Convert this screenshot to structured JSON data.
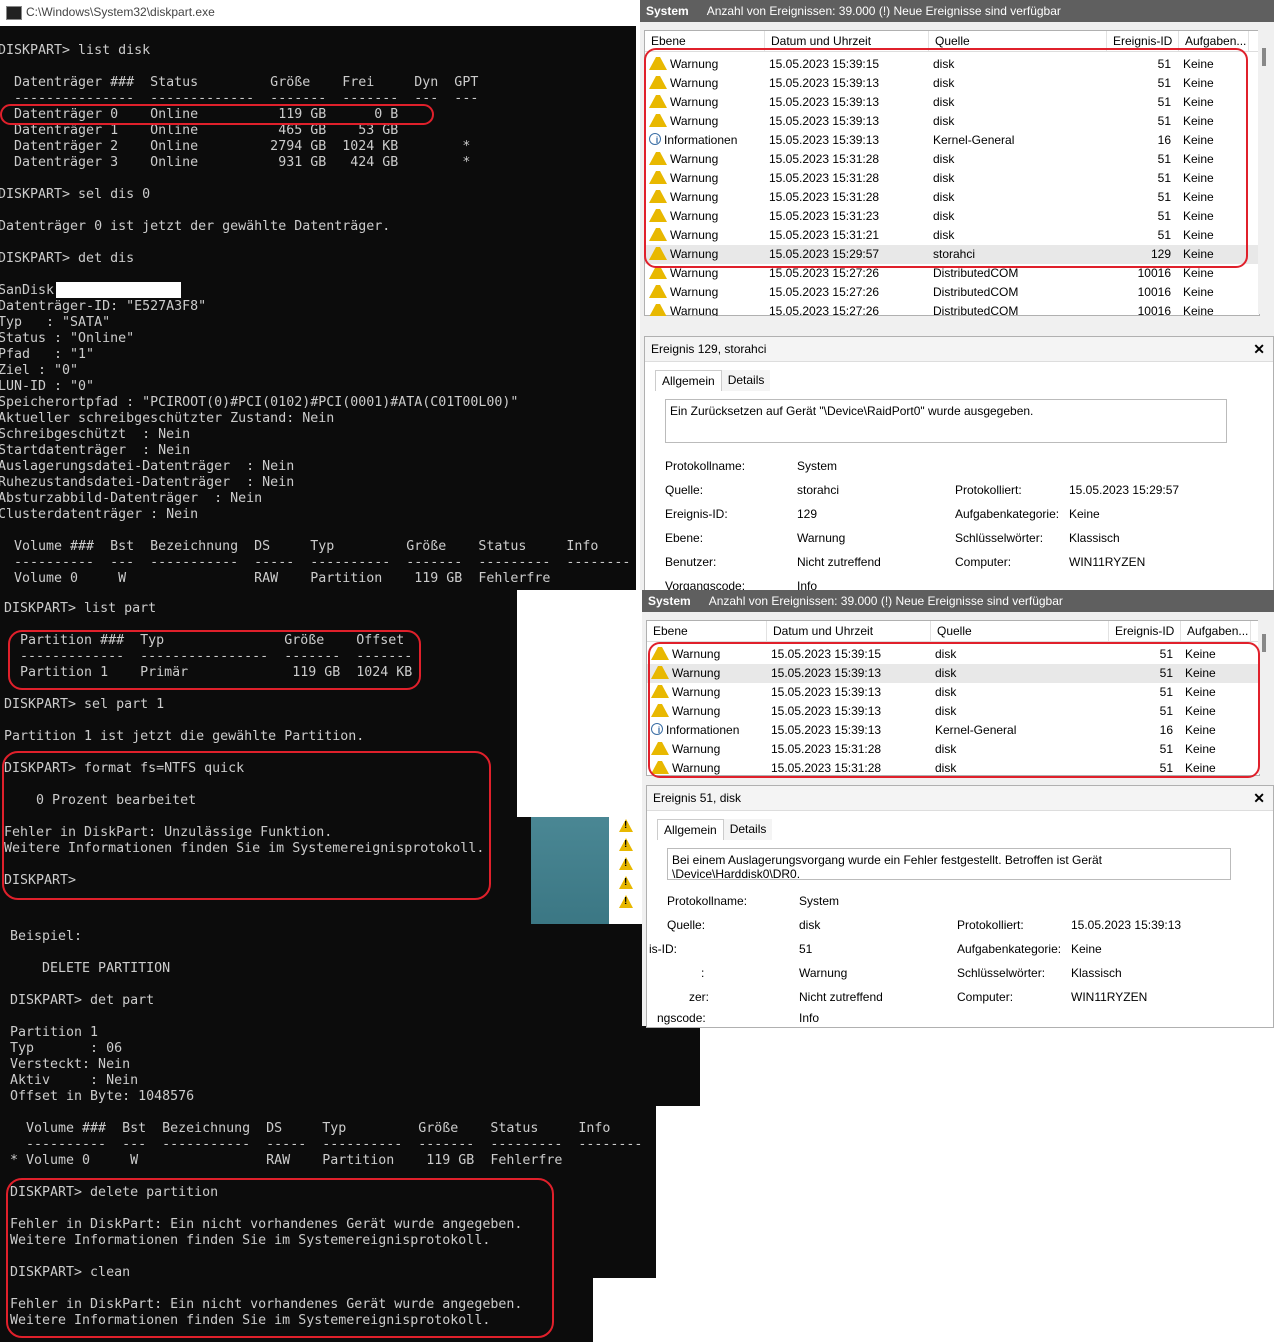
{
  "console_window": {
    "title": "C:\\Windows\\System32\\diskpart.exe"
  },
  "console_top_lines": [
    "",
    "DISKPART> list disk",
    "",
    "  Datenträger ###  Status         Größe    Frei     Dyn  GPT",
    "  ---------------  -------------  -------  -------  ---  ---",
    "  Datenträger 0    Online          119 GB      0 B",
    "  Datenträger 1    Online          465 GB    53 GB",
    "  Datenträger 2    Online         2794 GB  1024 KB        *",
    "  Datenträger 3    Online          931 GB   424 GB        *",
    "",
    "DISKPART> sel dis 0",
    "",
    "Datenträger 0 ist jetzt der gewählte Datenträger.",
    "",
    "DISKPART> det dis",
    "",
    "SanDisk",
    "Datenträger-ID: \"E527A3F8\"",
    "Typ   : \"SATA\"",
    "Status : \"Online\"",
    "Pfad   : \"1\"",
    "Ziel : \"0\"",
    "LUN-ID : \"0\"",
    "Speicherortpfad : \"PCIROOT(0)#PCI(0102)#PCI(0001)#ATA(C01T00L00)\"",
    "Aktueller schreibgeschützter Zustand: Nein",
    "Schreibgeschützt  : Nein",
    "Startdatenträger  : Nein",
    "Auslagerungsdatei-Datenträger  : Nein",
    "Ruhezustandsdatei-Datenträger  : Nein",
    "Absturzabbild-Datenträger  : Nein",
    "Clusterdatenträger : Nein",
    "",
    "  Volume ###  Bst  Bezeichnung  DS     Typ         Größe    Status     Info",
    "  ----------  ---  -----------  -----  ----------  -------  ---------  --------",
    "  Volume 0     W                RAW    Partition    119 GB  Fehlerfre"
  ],
  "console_mid_lines": [
    "DISKPART> list part",
    "",
    "  Partition ###  Typ               Größe    Offset",
    "  -------------  ----------------  -------  -------",
    "  Partition 1    Primär             119 GB  1024 KB",
    "",
    "DISKPART> sel part 1",
    "",
    "Partition 1 ist jetzt die gewählte Partition.",
    "",
    "DISKPART> format fs=NTFS quick",
    "",
    "    0 Prozent bearbeitet",
    "",
    "Fehler in DiskPart: Unzulässige Funktion.",
    "Weitere Informationen finden Sie im Systemereignisprotokoll.",
    "",
    "DISKPART>"
  ],
  "console_bottom_lines": [
    "Beispiel:",
    "",
    "    DELETE PARTITION",
    "",
    "DISKPART> det part",
    "",
    "Partition 1",
    "Typ       : 06",
    "Versteckt: Nein",
    "Aktiv     : Nein",
    "Offset in Byte: 1048576",
    "",
    "  Volume ###  Bst  Bezeichnung  DS     Typ         Größe    Status     Info",
    "  ----------  ---  -----------  -----  ----------  -------  ---------  --------",
    "* Volume 0     W                RAW    Partition    119 GB  Fehlerfre",
    "",
    "DISKPART> delete partition",
    "",
    "Fehler in DiskPart: Ein nicht vorhandenes Gerät wurde angegeben.",
    "Weitere Informationen finden Sie im Systemereignisprotokoll.",
    "",
    "DISKPART> clean",
    "",
    "Fehler in DiskPart: Ein nicht vorhandenes Gerät wurde angegeben.",
    "Weitere Informationen finden Sie im Systemereignisprotokoll."
  ],
  "event_viewer_1": {
    "header_name": "System",
    "header_text": "Anzahl von Ereignissen: 39.000 (!) Neue Ereignisse sind verfügbar",
    "columns": [
      "Ebene",
      "Datum und Uhrzeit",
      "Quelle",
      "Ereignis-ID",
      "Aufgaben..."
    ],
    "rows": [
      {
        "level": "Warnung",
        "icon": "warning-icon",
        "date": "15.05.2023 15:39:15",
        "source": "disk",
        "id": "51",
        "task": "Keine"
      },
      {
        "level": "Warnung",
        "icon": "warning-icon",
        "date": "15.05.2023 15:39:13",
        "source": "disk",
        "id": "51",
        "task": "Keine"
      },
      {
        "level": "Warnung",
        "icon": "warning-icon",
        "date": "15.05.2023 15:39:13",
        "source": "disk",
        "id": "51",
        "task": "Keine"
      },
      {
        "level": "Warnung",
        "icon": "warning-icon",
        "date": "15.05.2023 15:39:13",
        "source": "disk",
        "id": "51",
        "task": "Keine"
      },
      {
        "level": "Informationen",
        "icon": "info-icon",
        "date": "15.05.2023 15:39:13",
        "source": "Kernel-General",
        "id": "16",
        "task": "Keine"
      },
      {
        "level": "Warnung",
        "icon": "warning-icon",
        "date": "15.05.2023 15:31:28",
        "source": "disk",
        "id": "51",
        "task": "Keine"
      },
      {
        "level": "Warnung",
        "icon": "warning-icon",
        "date": "15.05.2023 15:31:28",
        "source": "disk",
        "id": "51",
        "task": "Keine"
      },
      {
        "level": "Warnung",
        "icon": "warning-icon",
        "date": "15.05.2023 15:31:28",
        "source": "disk",
        "id": "51",
        "task": "Keine"
      },
      {
        "level": "Warnung",
        "icon": "warning-icon",
        "date": "15.05.2023 15:31:23",
        "source": "disk",
        "id": "51",
        "task": "Keine"
      },
      {
        "level": "Warnung",
        "icon": "warning-icon",
        "date": "15.05.2023 15:31:21",
        "source": "disk",
        "id": "51",
        "task": "Keine"
      },
      {
        "level": "Warnung",
        "icon": "warning-icon",
        "date": "15.05.2023 15:29:57",
        "source": "storahci",
        "id": "129",
        "task": "Keine",
        "selected": true
      },
      {
        "level": "Warnung",
        "icon": "warning-icon",
        "date": "15.05.2023 15:27:26",
        "source": "DistributedCOM",
        "id": "10016",
        "task": "Keine"
      },
      {
        "level": "Warnung",
        "icon": "warning-icon",
        "date": "15.05.2023 15:27:26",
        "source": "DistributedCOM",
        "id": "10016",
        "task": "Keine"
      },
      {
        "level": "Warnung",
        "icon": "warning-icon",
        "date": "15.05.2023 15:27:26",
        "source": "DistributedCOM",
        "id": "10016",
        "task": "Keine"
      }
    ],
    "detail": {
      "title": "Ereignis 129, storahci",
      "close": "✕",
      "tab_general": "Allgemein",
      "tab_details": "Details",
      "message": "Ein Zurücksetzen auf Gerät \"\\Device\\RaidPort0\" wurde ausgegeben.",
      "fields": {
        "logname_label": "Protokollname:",
        "logname": "System",
        "source_label": "Quelle:",
        "source": "storahci",
        "logged_label": "Protokolliert:",
        "logged": "15.05.2023 15:29:57",
        "eventid_label": "Ereignis-ID:",
        "eventid": "129",
        "taskcat_label": "Aufgabenkategorie:",
        "taskcat": "Keine",
        "level_label": "Ebene:",
        "level": "Warnung",
        "keywords_label": "Schlüsselwörter:",
        "keywords": "Klassisch",
        "user_label": "Benutzer:",
        "user": "Nicht zutreffend",
        "computer_label": "Computer:",
        "computer": "WIN11RYZEN",
        "opcode_label": "Vorgangscode:",
        "opcode": "Info"
      }
    }
  },
  "event_viewer_2": {
    "header_name": "System",
    "header_text": "Anzahl von Ereignissen: 39.000 (!) Neue Ereignisse sind verfügbar",
    "columns": [
      "Ebene",
      "Datum und Uhrzeit",
      "Quelle",
      "Ereignis-ID",
      "Aufgaben..."
    ],
    "rows": [
      {
        "level": "Warnung",
        "icon": "warning-icon",
        "date": "15.05.2023 15:39:15",
        "source": "disk",
        "id": "51",
        "task": "Keine"
      },
      {
        "level": "Warnung",
        "icon": "warning-icon",
        "date": "15.05.2023 15:39:13",
        "source": "disk",
        "id": "51",
        "task": "Keine",
        "selected": true
      },
      {
        "level": "Warnung",
        "icon": "warning-icon",
        "date": "15.05.2023 15:39:13",
        "source": "disk",
        "id": "51",
        "task": "Keine"
      },
      {
        "level": "Warnung",
        "icon": "warning-icon",
        "date": "15.05.2023 15:39:13",
        "source": "disk",
        "id": "51",
        "task": "Keine"
      },
      {
        "level": "Informationen",
        "icon": "info-icon",
        "date": "15.05.2023 15:39:13",
        "source": "Kernel-General",
        "id": "16",
        "task": "Keine"
      },
      {
        "level": "Warnung",
        "icon": "warning-icon",
        "date": "15.05.2023 15:31:28",
        "source": "disk",
        "id": "51",
        "task": "Keine"
      },
      {
        "level": "Warnung",
        "icon": "warning-icon",
        "date": "15.05.2023 15:31:28",
        "source": "disk",
        "id": "51",
        "task": "Keine"
      }
    ],
    "detail": {
      "title": "Ereignis 51, disk",
      "close": "✕",
      "tab_general": "Allgemein",
      "tab_details": "Details",
      "message": "Bei einem Auslagerungsvorgang wurde ein Fehler festgestellt. Betroffen ist Gerät \\Device\\Harddisk0\\DR0.",
      "fields": {
        "logname_label": "Protokollname:",
        "logname": "System",
        "source_label": "Quelle:",
        "source": "disk",
        "logged_label": "Protokolliert:",
        "logged": "15.05.2023 15:39:13",
        "eventid_label": "is-ID:",
        "eventid": "51",
        "taskcat_label": "Aufgabenkategorie:",
        "taskcat": "Keine",
        "level_label": ":",
        "level": "Warnung",
        "keywords_label": "Schlüsselwörter:",
        "keywords": "Klassisch",
        "user_label": "zer:",
        "user": "Nicht zutreffend",
        "computer_label": "Computer:",
        "computer": "WIN11RYZEN",
        "opcode_label": "ngscode:",
        "opcode": "Info"
      }
    }
  },
  "colors": {
    "console_bg": "#0c0c0c",
    "console_fg": "#cccccc",
    "highlight_ring": "#e0202b",
    "event_header_bg": "#5f5f5f",
    "warning_icon": "#e8b800"
  }
}
